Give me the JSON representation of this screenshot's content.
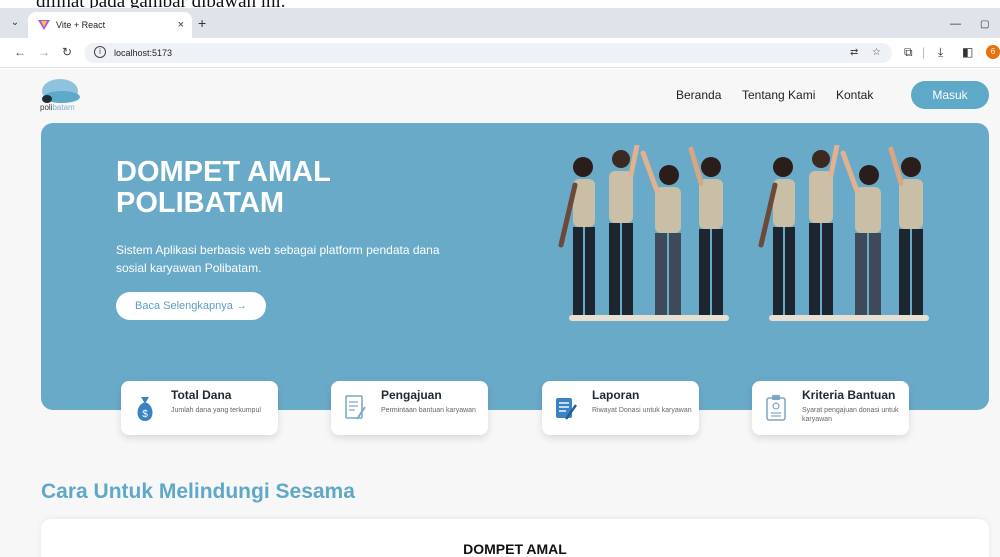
{
  "caption": "dilihat pada gambar dibawah ini.",
  "browser": {
    "tab_title": "Vite + React",
    "tab_close": "×",
    "new_tab": "+",
    "url": "localhost:5173",
    "profile_initial": "6"
  },
  "site": {
    "logo_text_left": "poli",
    "logo_text_right": "batam",
    "nav": [
      "Beranda",
      "Tentang Kami",
      "Kontak"
    ],
    "login_label": "Masuk"
  },
  "hero": {
    "title": "DOMPET AMAL POLIBATAM",
    "subtitle": "Sistem Aplikasi berbasis web sebagai platform pendata dana sosial karyawan Polibatam.",
    "button": "Baca Selengkapnya  →"
  },
  "cards": [
    {
      "title": "Total Dana",
      "desc": "Jumlah dana yang terkumpul",
      "icon": "money-bag-icon"
    },
    {
      "title": "Pengajuan",
      "desc": "Permintaan bantuan karyawan",
      "icon": "form-icon"
    },
    {
      "title": "Laporan",
      "desc": "Riwayat Donasi untuk karyawan",
      "icon": "report-icon"
    },
    {
      "title": "Kriteria Bantuan",
      "desc": "Syarat pengajuan donasi untuk karyawan",
      "icon": "clipboard-icon"
    }
  ],
  "section": {
    "title": "Cara Untuk Melindungi Sesama",
    "panel_title": "DOMPET AMAL"
  },
  "colors": {
    "accent": "#5ea8c8",
    "hero_bg": "#6aaac9"
  }
}
